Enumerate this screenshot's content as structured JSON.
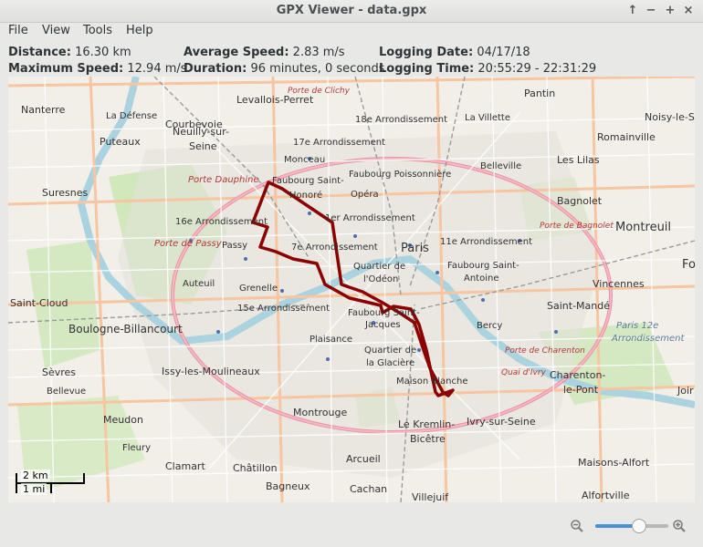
{
  "window": {
    "title": "GPX Viewer - data.gpx",
    "buttons": {
      "up": "↑",
      "minimize": "−",
      "maximize": "+",
      "close": "×"
    }
  },
  "menu": [
    "File",
    "View",
    "Tools",
    "Help"
  ],
  "stats": {
    "distance_label": "Distance:",
    "distance": "16.30 km",
    "avg_speed_label": "Average Speed:",
    "avg_speed": "2.83 m/s",
    "logging_date_label": "Logging Date:",
    "logging_date": "04/17/18",
    "max_speed_label": "Maximum Speed:",
    "max_speed": "12.94 m/s",
    "duration_label": "Duration:",
    "duration": "96 minutes, 0 seconds",
    "logging_time_label": "Logging Time:",
    "logging_time": "20:55:29 - 22:31:29"
  },
  "map": {
    "labels": [
      "Nanterre",
      "Courbevoie",
      "Levallois-Perret",
      "Pantin",
      "Noisy-le-S",
      "La Défense",
      "Puteaux",
      "Neuilly-sur-",
      "Seine",
      "Romainville",
      "18e Arrondissement",
      "La Villette",
      "17e Arrondissement",
      "Monceau",
      "Faubourg Poissonnière",
      "Les Lilas",
      "Suresnes",
      "Porte Dauphine",
      "Faubourg Saint-",
      "Honoré",
      "Opéra",
      "Belleville",
      "Bagnolet",
      "16e Arrondissement",
      "Porte de Passy",
      "1er Arrondissement",
      "Paris",
      "Montreuil",
      "Passy",
      "7e Arrondissement",
      "11e Arrondissement",
      "Faubourg Saint-",
      "Antoine",
      "Auteuil",
      "Grenelle",
      "Quartier de",
      "l'Odéon",
      "Vincennes",
      "Saint-Cloud",
      "15e Arrondissement",
      "Faubourg Saint-",
      "Jacques",
      "Saint-Mandé",
      "Boulogne-Billancourt",
      "Bercy",
      "Paris 12e",
      "Arrondissement",
      "Plaisance",
      "Quartier de",
      "la Glacière",
      "Sèvres",
      "Issy-les-Moulineaux",
      "Charenton-",
      "le-Pont",
      "Maison Blanche",
      "Bellevue",
      "Meudon",
      "Montrouge",
      "Ivry-sur-Seine",
      "Le Kremlin-",
      "Bicêtre",
      "Fleury",
      "Clamart",
      "Châtillon",
      "Arcueil",
      "Maisons-Alfort",
      "Bagneux",
      "Cachan",
      "Villejuif",
      "Alfortville",
      "Porte de Clichy",
      "Porte de Bagnolet",
      "Porte de Charenton",
      "Quai d'Ivry",
      "Fo",
      "Joir",
      "Ivry-sur-Seine"
    ],
    "scale_km": "2 km",
    "scale_mi": "1 mi"
  },
  "zoom": {
    "value": 0.6,
    "zoom_out_icon": "zoom-out-icon",
    "zoom_in_icon": "zoom-in-icon"
  },
  "colors": {
    "track": "#8b0000",
    "accent": "#4a90d9"
  }
}
